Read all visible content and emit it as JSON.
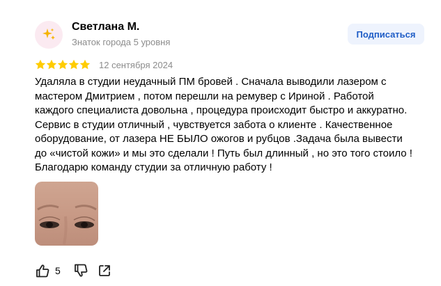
{
  "author": {
    "name": "Светлана М.",
    "level": "Знаток города 5 уровня",
    "avatar_icon": "sparkles-icon"
  },
  "subscribe": {
    "label": "Подписаться"
  },
  "review": {
    "rating": 5,
    "rating_max": 5,
    "date": "12 сентября 2024",
    "text": "Удаляла в студии неудачный ПМ бровей . Сначала выводили лазером с мастером Дмитрием , потом перешли на ремувер с Ириной . Работой каждого специалиста довольна , процедура происходит быстро и аккуратно. Сервис в студии отличный , чувствуется забота о клиенте . Качественное оборудование, от лазера НЕ БЫЛО ожогов и рубцов .Задача была вывести до «чистой кожи» и мы это сделали ! Путь был длинный , но это того стоило ! Благодарю команду студии за отличную работу !"
  },
  "actions": {
    "like_count": "5",
    "like_icon": "thumbs-up-icon",
    "dislike_icon": "thumbs-down-icon",
    "share_icon": "share-icon"
  },
  "colors": {
    "star": "#ffcc00",
    "accent": "#1f5dc6",
    "button_bg": "#eef3fd",
    "muted_text": "#8c8c8c",
    "avatar_bg": "#fbeaf1"
  }
}
